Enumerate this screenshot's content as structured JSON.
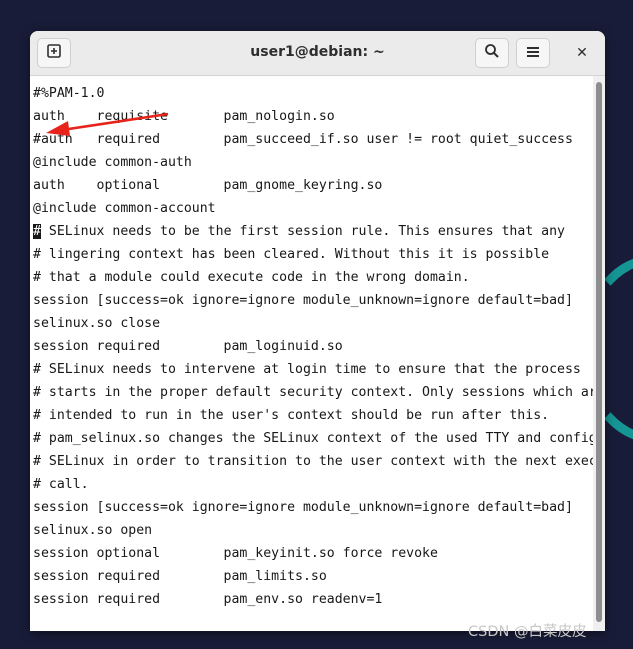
{
  "window": {
    "title": "user1@debian: ~"
  },
  "toolbar": {
    "new_tab_icon": "new-tab-icon",
    "search_icon": "search-icon",
    "menu_icon": "hamburger-menu-icon",
    "close_label": "✕"
  },
  "terminal": {
    "cursor_char": "#",
    "cursor_rest": " SELinux needs to be the first session rule. This ensures that any",
    "lines": [
      "#%PAM-1.0",
      "auth    requisite       pam_nologin.so",
      "#auth   required        pam_succeed_if.so user != root quiet_success",
      "@include common-auth",
      "auth    optional        pam_gnome_keyring.so",
      "@include common-account",
      "# SELinux needs to be the first session rule. This ensures that any",
      "# lingering context has been cleared. Without this it is possible",
      "# that a module could execute code in the wrong domain.",
      "session [success=ok ignore=ignore module_unknown=ignore default=bad]        pam_",
      "selinux.so close",
      "session required        pam_loginuid.so",
      "# SELinux needs to intervene at login time to ensure that the process",
      "# starts in the proper default security context. Only sessions which are",
      "# intended to run in the user's context should be run after this.",
      "# pam_selinux.so changes the SELinux context of the used TTY and configures",
      "# SELinux in order to transition to the user context with the next execve()",
      "# call.",
      "session [success=ok ignore=ignore module_unknown=ignore default=bad]        pam_",
      "selinux.so open",
      "session optional        pam_keyinit.so force revoke",
      "session required        pam_limits.so",
      "session required        pam_env.so readenv=1"
    ]
  },
  "watermark": "CSDN @白菜皮皮",
  "colors": {
    "annotation_arrow": "#e8231b",
    "desktop_bg": "#181c38",
    "desktop_accent": "#16a3a0"
  }
}
